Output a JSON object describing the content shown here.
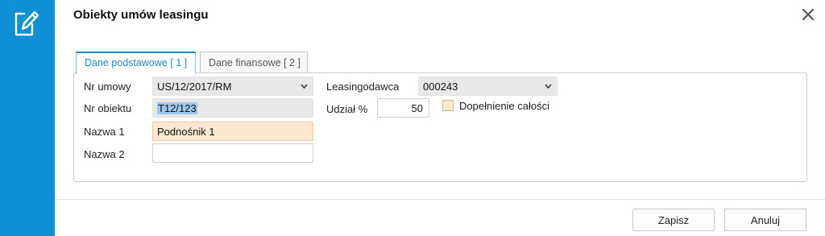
{
  "dialog": {
    "title": "Obiekty umów leasingu"
  },
  "tabs": [
    {
      "label": "Dane podstawowe [ 1 ]",
      "active": true
    },
    {
      "label": "Dane finansowe [ 2 ]",
      "active": false
    }
  ],
  "form": {
    "nr_umowy": {
      "label": "Nr umowy",
      "value": "US/12/2017/RM"
    },
    "nr_obiektu": {
      "label": "Nr obiektu",
      "value": "T12/123"
    },
    "nazwa1": {
      "label": "Nazwa 1",
      "value": "Podnośnik 1"
    },
    "nazwa2": {
      "label": "Nazwa 2",
      "value": ""
    },
    "leasingodawca": {
      "label": "Leasingodawca",
      "value": "000243"
    },
    "udzial": {
      "label": "Udział %",
      "value": "50"
    },
    "dopelnienie": {
      "label": "Dopełnienie całości",
      "checked": false
    }
  },
  "buttons": {
    "save": "Zapisz",
    "cancel": "Anuluj"
  },
  "colors": {
    "accent": "#0e8fd6",
    "required_field": "#fde7cf",
    "readonly_field": "#e8e8e8"
  },
  "icons": {
    "app": "edit-document-icon",
    "close": "close-icon",
    "dropdown": "chevron-down-icon"
  }
}
